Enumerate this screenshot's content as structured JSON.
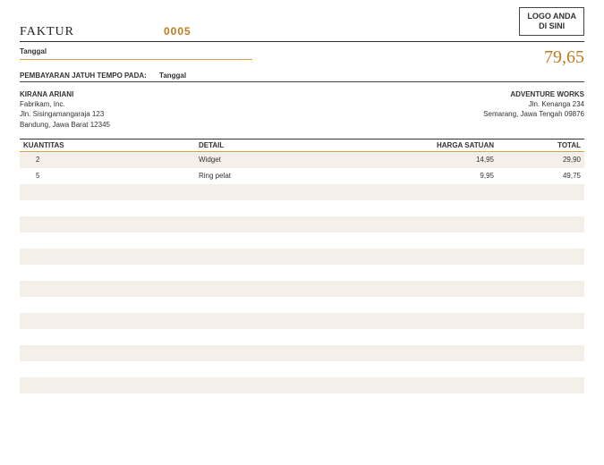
{
  "logo": {
    "line1": "LOGO ANDA",
    "line2": "DI SINI"
  },
  "header": {
    "title": "FAKTUR",
    "number": "0005",
    "date_label": "Tanggal",
    "total": "79,65",
    "due_label": "PEMBAYARAN JATUH TEMPO PADA:",
    "due_value": "Tanggal"
  },
  "from": {
    "name": "KIRANA ARIANI",
    "company": "Fabrikam, Inc.",
    "street": "Jln. Sisingamangaraja 123",
    "city": "Bandung, Jawa Barat 12345"
  },
  "to": {
    "name": "ADVENTURE WORKS",
    "street": "Jln. Kenanga 234",
    "city": "Semarang, Jawa Tengah 09876"
  },
  "columns": {
    "qty": "KUANTITAS",
    "detail": "DETAIL",
    "price": "HARGA SATUAN",
    "total": "TOTAL"
  },
  "items": [
    {
      "qty": "2",
      "detail": "Widget",
      "price": "14,95",
      "total": "29,90"
    },
    {
      "qty": "5",
      "detail": "Ring pelat",
      "price": "9,95",
      "total": "49,75"
    }
  ],
  "empty_rows": 14
}
